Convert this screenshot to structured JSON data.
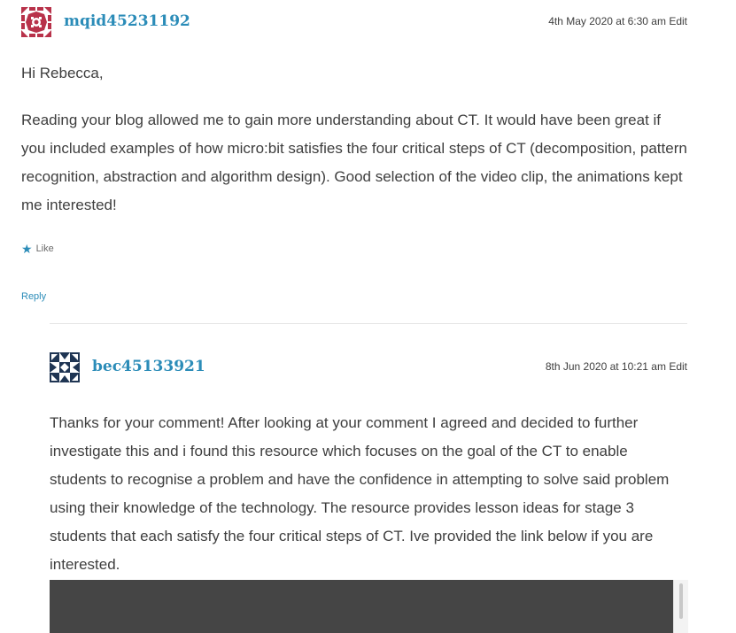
{
  "colors": {
    "link": "#2b8cb8",
    "text": "#3e3e3e",
    "video_bg": "#454545"
  },
  "comments": [
    {
      "author": "mqid45231192",
      "avatar_icon": "identicon-red",
      "date": "4th May 2020 at 6:30 am",
      "edit_label": "Edit",
      "paragraphs": [
        "Hi Rebecca,",
        "Reading your blog allowed me to gain more understanding about CT. It would have been great if you included examples of how micro:bit satisfies the four critical steps of CT (decomposition, pattern recognition, abstraction and algorithm design). Good selection of the video clip, the animations kept me interested!"
      ],
      "like_label": "Like",
      "reply_label": "Reply"
    },
    {
      "author": "bec45133921",
      "avatar_icon": "identicon-navy",
      "date": "8th Jun 2020 at 10:21 am",
      "edit_label": "Edit",
      "paragraphs": [
        "Thanks for your comment! After looking at your comment I agreed and decided to further investigate this and i found this resource which focuses on the goal of the CT to enable students to recognise a problem and have the confidence in attempting to solve said problem using their knowledge of the technology. The resource provides lesson ideas for stage 3 students that each satisfy the four critical steps of CT. Ive provided the link below if you are interested."
      ]
    }
  ]
}
